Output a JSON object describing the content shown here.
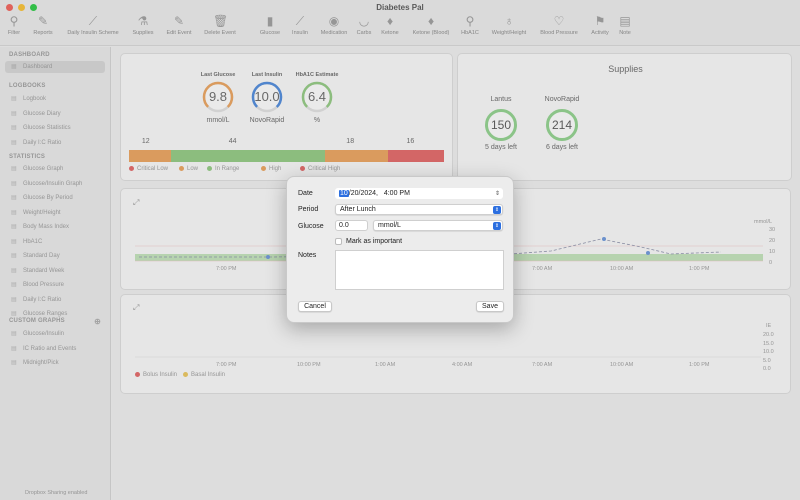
{
  "app": {
    "title": "Diabetes Pal",
    "status": "Dropbox Sharing enabled"
  },
  "toolbar": [
    {
      "label": "Filter",
      "icon": "filter-icon"
    },
    {
      "label": "Reports",
      "icon": "reports-icon"
    },
    {
      "label": "Daily Insulin Scheme",
      "icon": "syringe-icon"
    },
    {
      "label": "Supplies",
      "icon": "supplies-icon"
    },
    {
      "label": "Edit Event",
      "icon": "pencil-icon"
    },
    {
      "label": "Delete Event",
      "icon": "trash-icon"
    },
    {
      "label": "Glucose",
      "icon": "glucose-icon"
    },
    {
      "label": "Insulin",
      "icon": "insulin-icon"
    },
    {
      "label": "Medication",
      "icon": "pill-icon"
    },
    {
      "label": "Carbs",
      "icon": "banana-icon"
    },
    {
      "label": "Ketone",
      "icon": "drop-icon"
    },
    {
      "label": "Ketone (Blood)",
      "icon": "blood-drop-icon"
    },
    {
      "label": "HbA1C",
      "icon": "microscope-icon"
    },
    {
      "label": "Weight/Height",
      "icon": "scale-icon"
    },
    {
      "label": "Blood Pressure",
      "icon": "bp-icon"
    },
    {
      "label": "Activity",
      "icon": "activity-icon"
    },
    {
      "label": "Note",
      "icon": "note-icon"
    }
  ],
  "sidebar": {
    "dashboard_header": "DASHBOARD",
    "dashboard_item": "Dashboard",
    "logbooks_header": "LOGBOOKS",
    "logbooks": [
      "Logbook",
      "Glucose Diary",
      "Glucose Statistics",
      "Daily I:C Ratio"
    ],
    "statistics_header": "STATISTICS",
    "statistics": [
      "Glucose Graph",
      "Glucose/Insulin Graph",
      "Glucose By Period",
      "Weight/Height",
      "Body Mass Index",
      "HbA1C",
      "Standard Day",
      "Standard Week",
      "Blood Pressure",
      "Daily I:C Ratio",
      "Glucose Ranges"
    ],
    "custom_header": "CUSTOM GRAPHS",
    "custom": [
      "Glucose/Insulin",
      "IC Ratio and Events",
      "Midnight/Pick"
    ]
  },
  "dashboard": {
    "gauges": [
      {
        "label": "Last Glucose",
        "value": "9.8",
        "unit": "mmol/L",
        "color": "#e8a05a"
      },
      {
        "label": "Last Insulin",
        "value": "10.0",
        "unit": "NovoRapid",
        "color": "#4a87d9"
      },
      {
        "label": "HbA1C Estimate",
        "value": "6.4",
        "unit": "%",
        "color": "#8fc77f"
      }
    ],
    "ranges": [
      {
        "count": "12",
        "color": "#e8a05a",
        "flex": 12
      },
      {
        "count": "44",
        "color": "#8fc77f",
        "flex": 44
      },
      {
        "count": "18",
        "color": "#e8a05a",
        "flex": 18
      },
      {
        "count": "16",
        "color": "#e06464",
        "flex": 16
      }
    ],
    "legend": [
      {
        "label": "Critical Low",
        "color": "#e06464"
      },
      {
        "label": "Low",
        "color": "#e8a05a"
      },
      {
        "label": "In Range",
        "color": "#8fc77f"
      },
      {
        "label": "High",
        "color": "#e8a05a"
      },
      {
        "label": "Critical High",
        "color": "#e06464"
      }
    ],
    "supplies": {
      "title": "Supplies",
      "items": [
        {
          "name": "Lantus",
          "value": "150",
          "days": "5 days left"
        },
        {
          "name": "NovoRapid",
          "value": "214",
          "days": "6 days left"
        }
      ]
    },
    "glucose_chart": {
      "unit": "mmol/L",
      "y_ticks": [
        "30",
        "20",
        "10",
        "0"
      ],
      "x_ticks": [
        "7:00 PM",
        "10:00 PM",
        "1:00 AM",
        "4:00 AM",
        "7:00 AM",
        "10:00 AM",
        "1:00 PM"
      ]
    },
    "insulin_chart": {
      "unit": "IE",
      "y_ticks": [
        "20.0",
        "15.0",
        "10.0",
        "5.0",
        "0.0"
      ],
      "x_ticks": [
        "7:00 PM",
        "10:00 PM",
        "1:00 AM",
        "4:00 AM",
        "7:00 AM",
        "10:00 AM",
        "1:00 PM"
      ],
      "legend": [
        {
          "label": "Bolus Insulin",
          "color": "#e06464"
        },
        {
          "label": "Basal Insulin",
          "color": "#e8c35a"
        }
      ]
    }
  },
  "dialog": {
    "date_label": "Date",
    "date_month": "10",
    "date_rest": "/20/2024,",
    "time_value": "4:00 PM",
    "period_label": "Period",
    "period_value": "After Lunch",
    "glucose_label": "Glucose",
    "glucose_value": "0.0",
    "glucose_unit": "mmol/L",
    "important_label": "Mark as important",
    "notes_label": "Notes",
    "notes_value": "",
    "cancel": "Cancel",
    "save": "Save"
  }
}
